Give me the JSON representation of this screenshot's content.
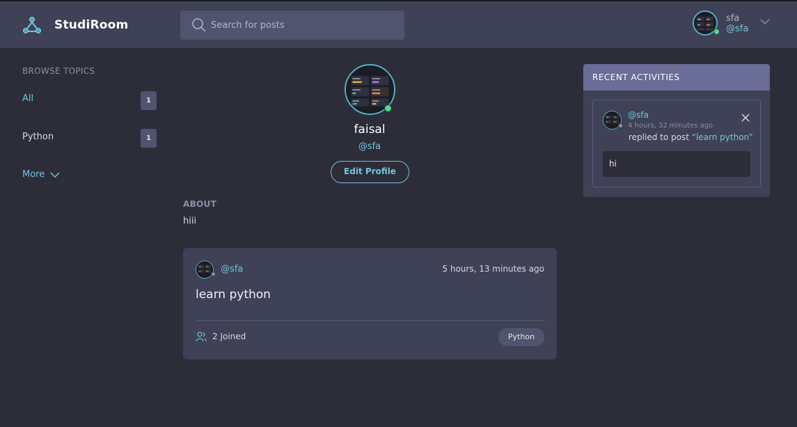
{
  "header": {
    "brand": "StudiRoom",
    "search_placeholder": "Search for posts",
    "user": {
      "name": "sfa",
      "handle": "@sfa"
    }
  },
  "sidebar": {
    "title": "BROWSE TOPICS",
    "topics": [
      {
        "label": "All",
        "count": "1"
      },
      {
        "label": "Python",
        "count": "1"
      }
    ],
    "more_label": "More"
  },
  "profile": {
    "name": "faisal",
    "handle": "@sfa",
    "edit_label": "Edit Profile",
    "about_title": "ABOUT",
    "about_text": "hiii"
  },
  "rooms": [
    {
      "host": "@sfa",
      "time": "5 hours, 13 minutes ago",
      "title": "learn python",
      "joined": "2 Joined",
      "topic": "Python"
    }
  ],
  "activities": {
    "title": "RECENT ACTIVITIES",
    "items": [
      {
        "user": "@sfa",
        "time": "4 hours, 32 minutes ago",
        "action": "replied to post ",
        "post": "“learn python”",
        "body": "hi"
      }
    ]
  },
  "colors": {
    "background": "#2d2d39",
    "header": "#3f4156",
    "accent": "#71c6dd",
    "activity_header": "#696d97",
    "online": "#54d98c"
  }
}
